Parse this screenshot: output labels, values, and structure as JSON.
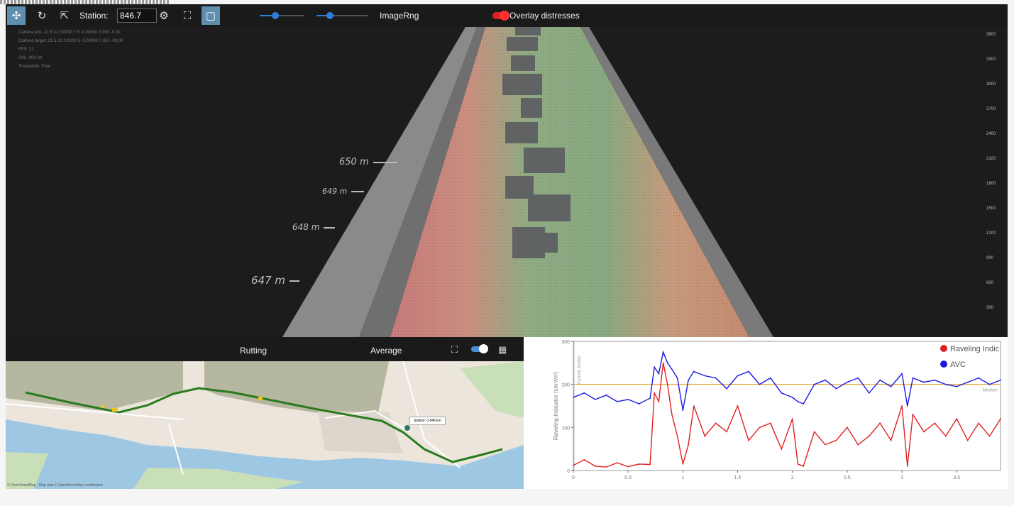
{
  "toolbar": {
    "station_label": "Station:",
    "station_value": "846.7",
    "imagerng_label": "ImageRng",
    "overlay_label": "Overlay distresses",
    "buttons": [
      {
        "name": "move-tool-button",
        "icon": "move-icon",
        "glyph": "✣",
        "active": true
      },
      {
        "name": "rotate-button",
        "icon": "rotate-icon",
        "glyph": "↻",
        "active": false
      },
      {
        "name": "export-button",
        "icon": "export-icon",
        "glyph": "⇱",
        "active": false
      },
      {
        "name": "settings-button",
        "icon": "gear-icon",
        "glyph": "⚙",
        "active": false
      },
      {
        "name": "fit-view-button",
        "icon": "focus-icon",
        "glyph": "⛶",
        "active": false
      },
      {
        "name": "layer-button",
        "icon": "layer-icon",
        "glyph": "▢",
        "active": true
      }
    ]
  },
  "viewer": {
    "info_lines": [
      "Camera pos: 21.5 21 0.0000 7.5 -0.00000 2.000 -0.00",
      "Camera target: 21.5 21 0.0000 5 -0.00000 7.331 -00.00",
      "FPS: 21",
      "AXL: 000.00",
      "Translation: Free"
    ],
    "station_marks": [
      "650 m",
      "649 m",
      "648 m",
      "647 m"
    ],
    "y_ticks": [
      "3600",
      "3300",
      "3000",
      "2700",
      "2400",
      "2100",
      "1800",
      "1500",
      "1200",
      "900",
      "600",
      "300"
    ]
  },
  "panel": {
    "left_title": "Rutting",
    "mid_title": "Average"
  },
  "map": {
    "attribution": "© OpenStreetMap · Map data © OpenStreetMap contributors",
    "tooltip": "Station: 0.846 km"
  },
  "chart_data": {
    "type": "line",
    "ylabel": "Raveling Indicator (cm³/m²)",
    "xlim": [
      0,
      3.9
    ],
    "ylim": [
      0,
      300
    ],
    "x_ticks": [
      "0",
      "0.5",
      "1",
      "1.5",
      "2",
      "2.5",
      "3",
      "3.5"
    ],
    "y_ticks": [
      "0",
      "100",
      "200",
      "300"
    ],
    "vline_label": "Current Station",
    "threshold": {
      "value": 200,
      "label": "Medium"
    },
    "legend_position": "top-right",
    "series": [
      {
        "name": "Raveling Indic",
        "color": "#e02020",
        "x": [
          0,
          0.1,
          0.2,
          0.3,
          0.4,
          0.5,
          0.6,
          0.7,
          0.74,
          0.78,
          0.82,
          0.86,
          0.9,
          0.95,
          1.0,
          1.05,
          1.1,
          1.2,
          1.3,
          1.4,
          1.5,
          1.6,
          1.7,
          1.8,
          1.9,
          2.0,
          2.05,
          2.1,
          2.2,
          2.3,
          2.4,
          2.5,
          2.6,
          2.7,
          2.8,
          2.9,
          3.0,
          3.05,
          3.1,
          3.2,
          3.3,
          3.4,
          3.5,
          3.6,
          3.7,
          3.8,
          3.9
        ],
        "values": [
          12,
          25,
          10,
          8,
          18,
          9,
          15,
          14,
          180,
          160,
          250,
          200,
          130,
          80,
          15,
          60,
          150,
          80,
          110,
          90,
          150,
          70,
          100,
          110,
          50,
          120,
          15,
          10,
          90,
          60,
          70,
          100,
          60,
          80,
          110,
          70,
          150,
          10,
          130,
          90,
          110,
          80,
          120,
          70,
          110,
          80,
          120
        ]
      },
      {
        "name": "AVC",
        "color": "#1a1ae0",
        "x": [
          0,
          0.1,
          0.2,
          0.3,
          0.4,
          0.5,
          0.6,
          0.7,
          0.74,
          0.78,
          0.82,
          0.86,
          0.9,
          0.95,
          1.0,
          1.05,
          1.1,
          1.2,
          1.3,
          1.4,
          1.5,
          1.6,
          1.7,
          1.8,
          1.9,
          2.0,
          2.05,
          2.1,
          2.2,
          2.3,
          2.4,
          2.5,
          2.6,
          2.7,
          2.8,
          2.9,
          3.0,
          3.05,
          3.1,
          3.2,
          3.3,
          3.4,
          3.5,
          3.6,
          3.7,
          3.8,
          3.9
        ],
        "values": [
          170,
          180,
          165,
          175,
          160,
          165,
          155,
          168,
          240,
          225,
          275,
          250,
          235,
          215,
          140,
          210,
          230,
          220,
          215,
          190,
          220,
          230,
          200,
          215,
          180,
          170,
          160,
          155,
          200,
          210,
          190,
          205,
          215,
          180,
          210,
          195,
          225,
          150,
          215,
          205,
          210,
          200,
          195,
          205,
          215,
          200,
          210
        ]
      }
    ]
  },
  "colors": {
    "accent": "#2e7dd6",
    "toolbar_bg": "#1a1a1a",
    "viewer_bg": "#1d1b1e",
    "overlay_toggle": "#e02020"
  }
}
